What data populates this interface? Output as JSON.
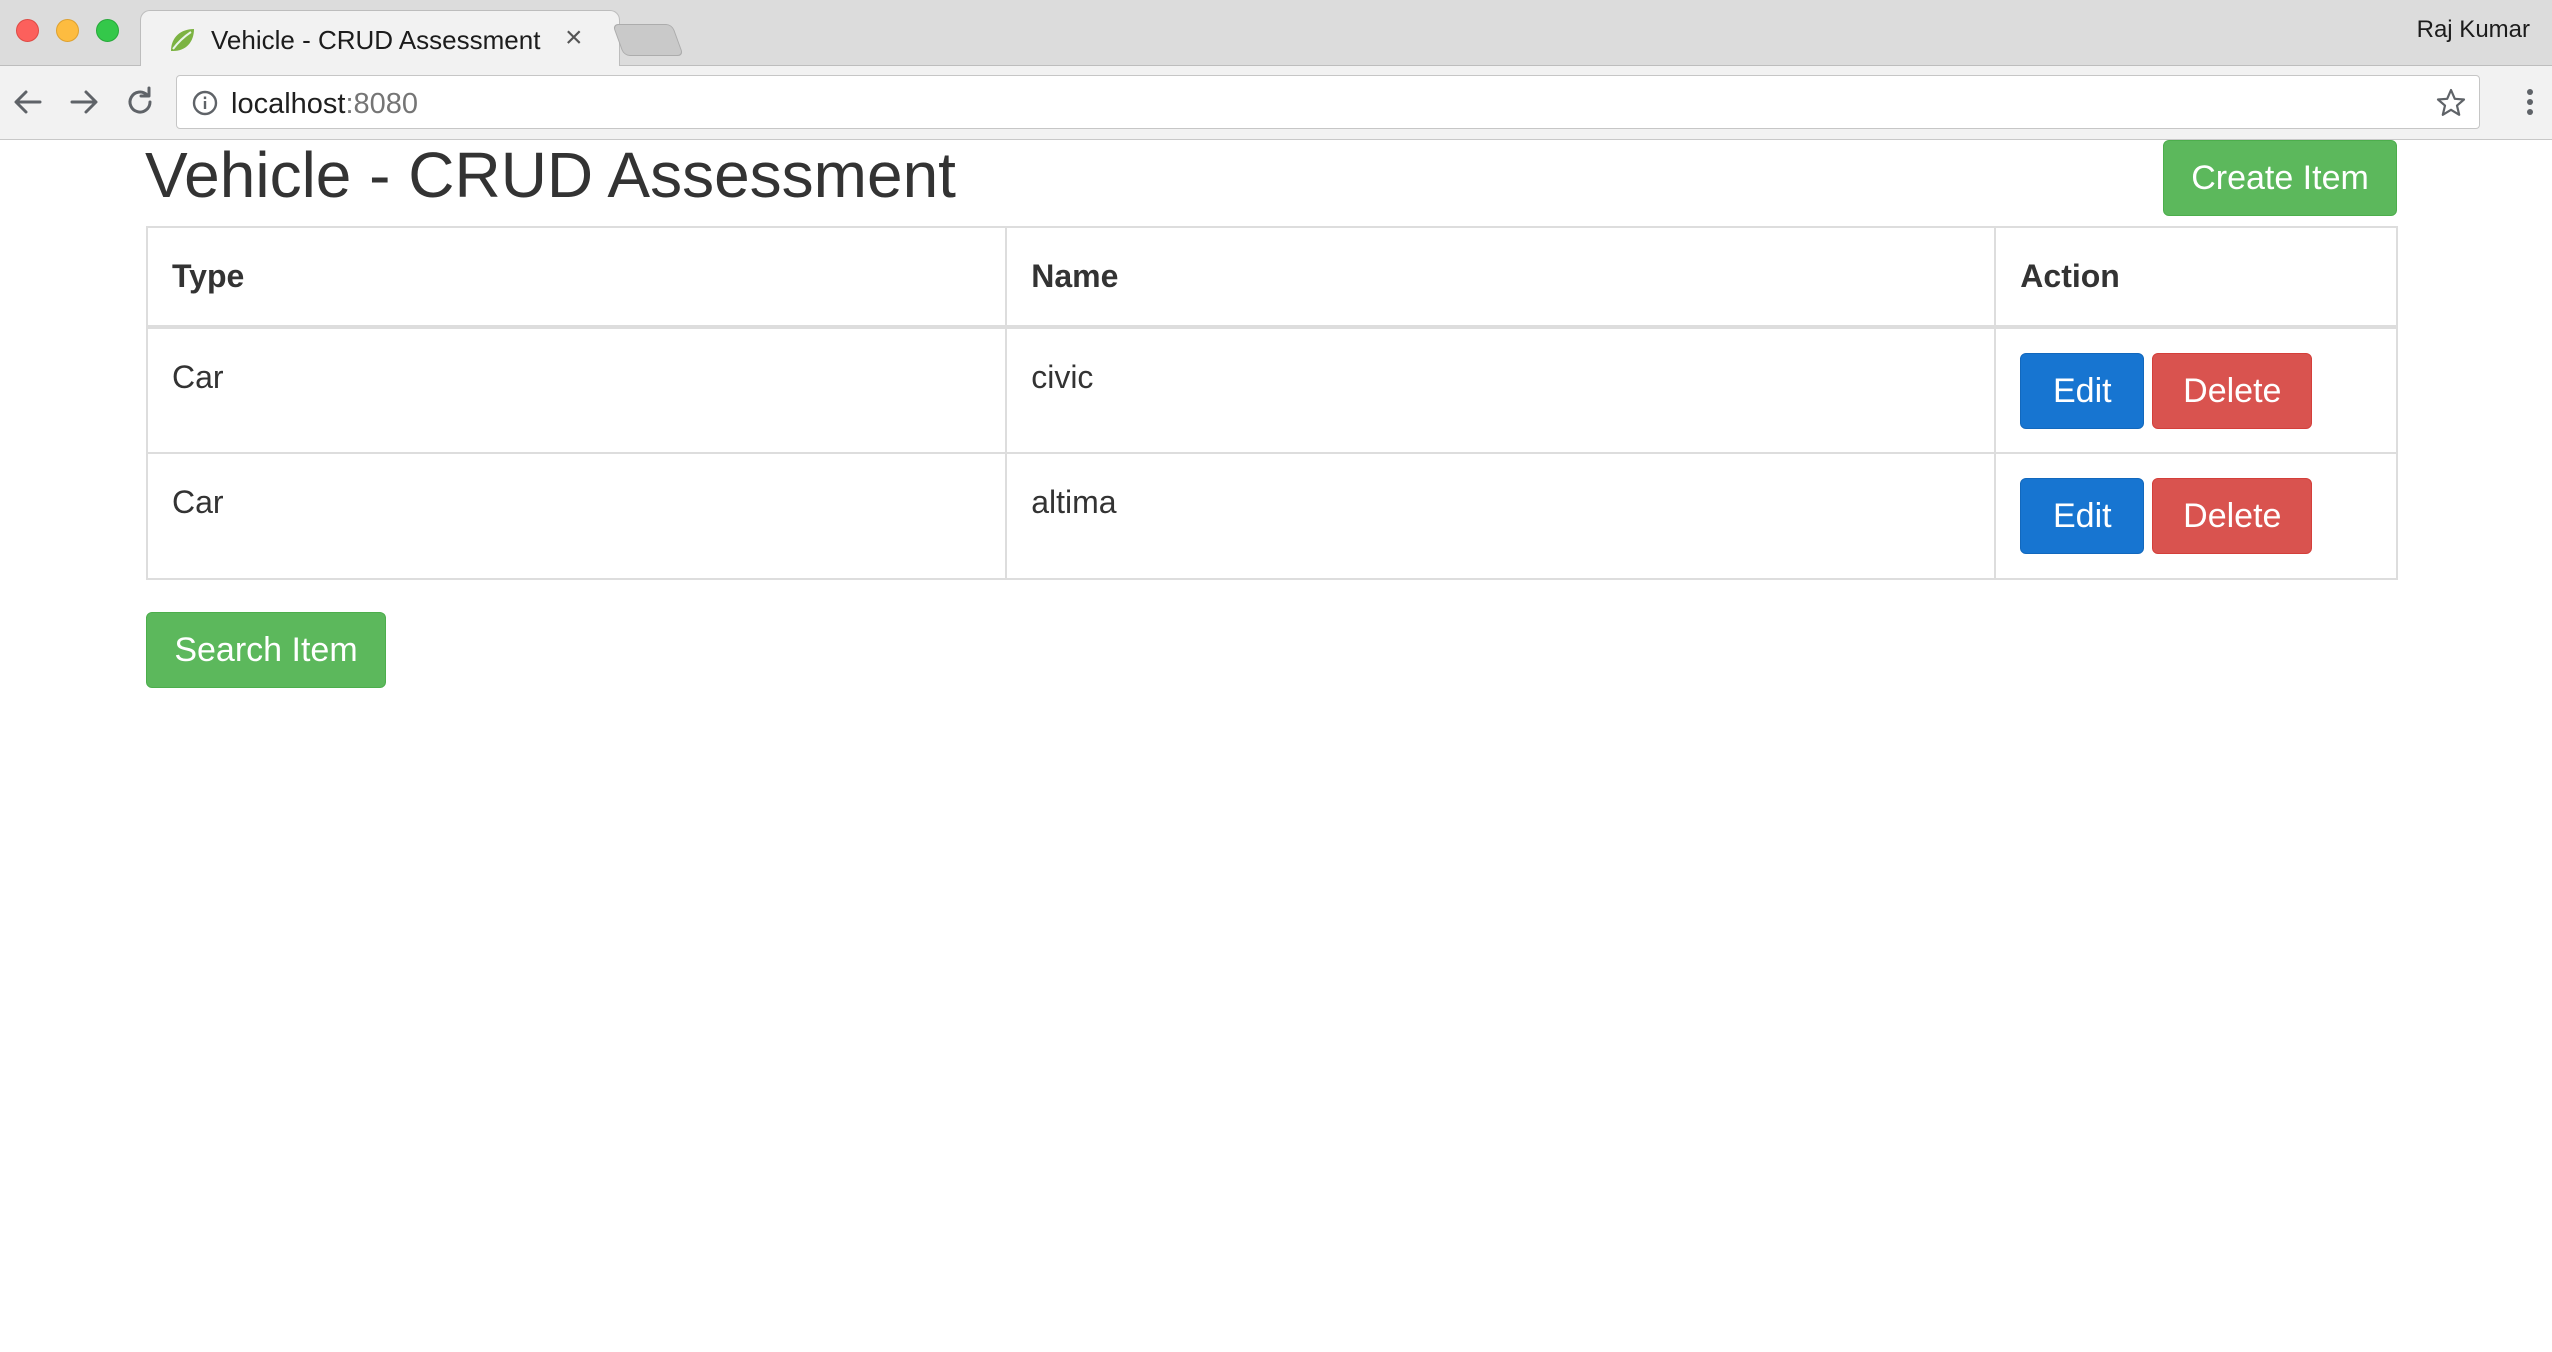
{
  "browser": {
    "tab_title": "Vehicle - CRUD Assessment",
    "tab_close": "×",
    "profile_name": "Raj Kumar",
    "url_host": "localhost",
    "url_port": ":8080"
  },
  "page": {
    "title": "Vehicle - CRUD Assessment",
    "create_label": "Create Item",
    "search_label": "Search Item"
  },
  "table": {
    "headers": [
      "Type",
      "Name",
      "Action"
    ],
    "rows": [
      {
        "type": "Car",
        "name": "civic",
        "edit_label": "Edit",
        "delete_label": "Delete"
      },
      {
        "type": "Car",
        "name": "altima",
        "edit_label": "Edit",
        "delete_label": "Delete"
      }
    ]
  },
  "colors": {
    "success": "#5cb85c",
    "primary": "#1775d1",
    "danger": "#d9534f"
  },
  "icons": [
    "spring-leaf-icon",
    "back-arrow-icon",
    "forward-arrow-icon",
    "reload-icon",
    "info-icon",
    "star-icon",
    "more-vert-icon"
  ]
}
